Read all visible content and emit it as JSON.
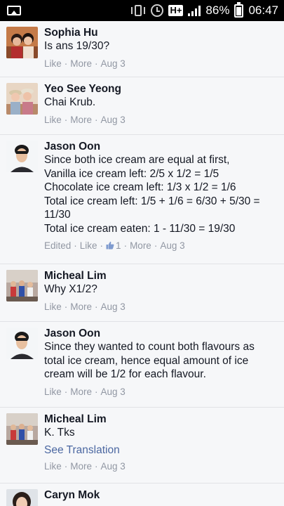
{
  "status_bar": {
    "battery_pct": "86%",
    "time": "06:47",
    "network": "H+"
  },
  "comments": [
    {
      "name": "Sophia Hu",
      "text": "Is ans 19/30?",
      "like": "Like",
      "more": "More",
      "date": "Aug 3"
    },
    {
      "name": "Yeo See Yeong",
      "text": "Chai Krub.",
      "like": "Like",
      "more": "More",
      "date": "Aug 3"
    },
    {
      "name": "Jason Oon",
      "text": "Since both ice cream are equal at first,\nVanilla ice cream left: 2/5 x 1/2 = 1/5\nChocolate ice cream left: 1/3 x 1/2 = 1/6\nTotal ice cream left: 1/5 + 1/6 = 6/30 + 5/30 =\n11/30\nTotal ice cream eaten: 1 - 11/30 = 19/30",
      "edited": "Edited",
      "like": "Like",
      "like_count": "1",
      "more": "More",
      "date": "Aug 3"
    },
    {
      "name": "Micheal Lim",
      "text": "Why X1/2?",
      "like": "Like",
      "more": "More",
      "date": "Aug 3"
    },
    {
      "name": "Jason Oon",
      "text": "Since they wanted to count both flavours as\ntotal ice cream, hence equal amount of ice\ncream will be 1/2 for each flavour.",
      "like": "Like",
      "more": "More",
      "date": "Aug 3"
    },
    {
      "name": "Micheal Lim",
      "text": "K. Tks",
      "see_translation": "See Translation",
      "like": "Like",
      "more": "More",
      "date": "Aug 3"
    },
    {
      "name": "Caryn Mok"
    }
  ],
  "colors": {
    "background": "#f6f7f9",
    "meta_text": "#9197a3",
    "link_blue": "#4b67a1",
    "name_text": "#141823"
  }
}
